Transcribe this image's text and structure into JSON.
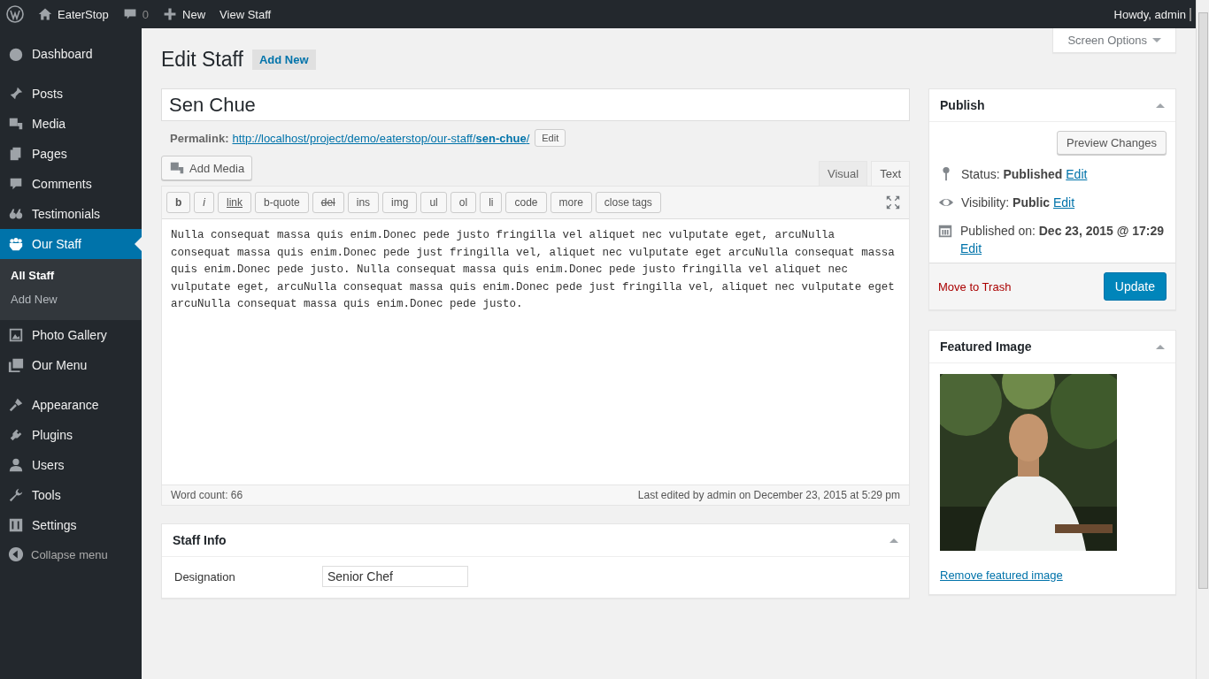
{
  "admin_bar": {
    "site_name": "EaterStop",
    "comments_count": "0",
    "new_label": "New",
    "view_label": "View Staff",
    "greeting": "Howdy, admin"
  },
  "sidebar": {
    "groups": [
      {
        "items": [
          {
            "label": "Dashboard",
            "selected": false
          }
        ]
      },
      {
        "items": [
          {
            "label": "Posts",
            "selected": false
          },
          {
            "label": "Media",
            "selected": false
          },
          {
            "label": "Pages",
            "selected": false
          },
          {
            "label": "Comments",
            "selected": false
          },
          {
            "label": "Testimonials",
            "selected": false
          },
          {
            "label": "Our Staff",
            "selected": true,
            "children": [
              {
                "label": "All Staff",
                "selected": true
              },
              {
                "label": "Add New",
                "selected": false
              }
            ]
          },
          {
            "label": "Photo Gallery",
            "selected": false
          },
          {
            "label": "Our Menu",
            "selected": false
          }
        ]
      },
      {
        "items": [
          {
            "label": "Appearance",
            "selected": false
          },
          {
            "label": "Plugins",
            "selected": false
          },
          {
            "label": "Users",
            "selected": false
          },
          {
            "label": "Tools",
            "selected": false
          },
          {
            "label": "Settings",
            "selected": false
          }
        ]
      }
    ],
    "collapse_label": "Collapse menu"
  },
  "screen_options": "Screen Options",
  "page_title": "Edit Staff",
  "add_new": "Add New",
  "post_title": "Sen Chue",
  "permalink": {
    "label": "Permalink:",
    "url": "http://localhost/project/demo/eaterstop/our-staff/",
    "slug": "sen-chue",
    "trail": "/",
    "edit": "Edit"
  },
  "editor": {
    "add_media": "Add Media",
    "tabs": [
      {
        "label": "Visual",
        "selected": false
      },
      {
        "label": "Text",
        "selected": true
      }
    ],
    "quicktags": [
      {
        "label": "b",
        "kind": "bold"
      },
      {
        "label": "i",
        "kind": "italic"
      },
      {
        "label": "link",
        "kind": "underline"
      },
      {
        "label": "b-quote",
        "kind": "plain"
      },
      {
        "label": "del",
        "kind": "strike"
      },
      {
        "label": "ins",
        "kind": "plain"
      },
      {
        "label": "img",
        "kind": "plain"
      },
      {
        "label": "ul",
        "kind": "plain"
      },
      {
        "label": "ol",
        "kind": "plain"
      },
      {
        "label": "li",
        "kind": "plain"
      },
      {
        "label": "code",
        "kind": "plain"
      },
      {
        "label": "more",
        "kind": "plain"
      },
      {
        "label": "close tags",
        "kind": "plain"
      }
    ],
    "content": "Nulla consequat massa quis enim.Donec pede justo fringilla vel aliquet nec vulputate eget, arcuNulla consequat massa quis enim.Donec pede just fringilla vel, aliquet nec vulputate eget arcuNulla consequat massa quis enim.Donec pede justo. Nulla consequat massa quis enim.Donec pede justo fringilla vel aliquet nec vulputate eget, arcuNulla consequat massa quis enim.Donec pede just fringilla vel, aliquet nec vulputate eget arcuNulla consequat massa quis enim.Donec pede justo.",
    "word_count": "Word count: 66",
    "last_edited": "Last edited by admin on December 23, 2015 at 5:29 pm"
  },
  "staff_info": {
    "title": "Staff Info",
    "field_label": "Designation",
    "field_value": "Senior Chef"
  },
  "publish": {
    "title": "Publish",
    "preview": "Preview Changes",
    "rows": [
      {
        "label": "Status:",
        "value": "Published",
        "edit": "Edit"
      },
      {
        "label": "Visibility:",
        "value": "Public",
        "edit": "Edit"
      },
      {
        "label": "Published on:",
        "value": "Dec 23, 2015 @ 17:29",
        "edit": "Edit"
      }
    ],
    "trash": "Move to Trash",
    "update": "Update"
  },
  "featured_image": {
    "title": "Featured Image",
    "remove": "Remove featured image"
  }
}
